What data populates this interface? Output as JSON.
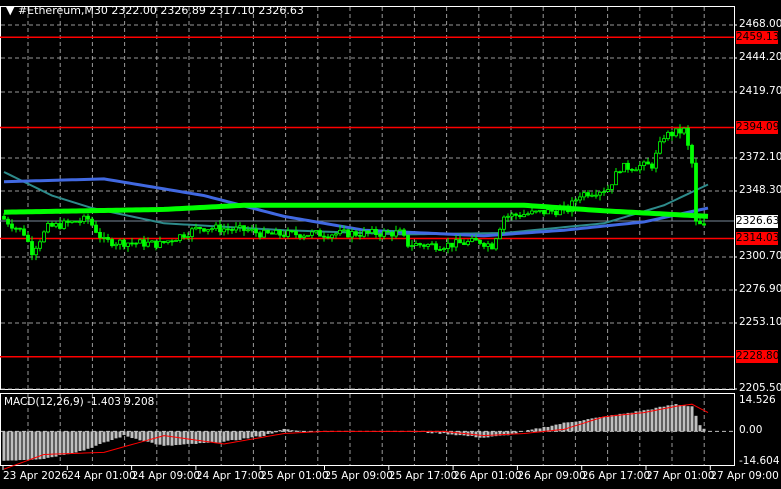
{
  "header": {
    "symbol": "#Ethereum,M30",
    "open": "2322.00",
    "high": "2326.89",
    "low": "2317.10",
    "close": "2326.63"
  },
  "price_axis": [
    "2468.00",
    "2444.20",
    "2419.70",
    "2372.10",
    "2348.30",
    "2300.70",
    "2276.90",
    "2253.10",
    "2205.50"
  ],
  "levels": [
    {
      "label": "2459.13",
      "price": 2459.13,
      "color": "#ff0000"
    },
    {
      "label": "2394.09",
      "price": 2394.09,
      "color": "#ff0000"
    },
    {
      "label": "2314.03",
      "price": 2314.03,
      "color": "#ff0000"
    },
    {
      "label": "2228.80",
      "price": 2228.8,
      "color": "#ff0000"
    }
  ],
  "current_price": {
    "label": "2326.63",
    "price": 2326.63
  },
  "macd": {
    "label": "MACD(12,26,9) -1.403 9.208",
    "axis": [
      "14.526",
      "0.00",
      "-14.604"
    ]
  },
  "time_axis": [
    "23 Apr 2026",
    "24 Apr 01:00",
    "24 Apr 09:00",
    "24 Apr 17:00",
    "25 Apr 01:00",
    "25 Apr 09:00",
    "25 Apr 17:00",
    "26 Apr 01:00",
    "26 Apr 09:00",
    "26 Apr 17:00",
    "27 Apr 01:00",
    "27 Apr 09:00"
  ],
  "chart_data": {
    "type": "candlestick",
    "ylim": [
      2205.5,
      2468.0
    ],
    "bars": 176,
    "close_keypoints": [
      [
        0,
        2330
      ],
      [
        6,
        2318
      ],
      [
        8,
        2305
      ],
      [
        12,
        2322
      ],
      [
        22,
        2328
      ],
      [
        26,
        2312
      ],
      [
        40,
        2310
      ],
      [
        50,
        2322
      ],
      [
        62,
        2320
      ],
      [
        66,
        2317
      ],
      [
        100,
        2318
      ],
      [
        102,
        2310
      ],
      [
        110,
        2309
      ],
      [
        120,
        2312
      ],
      [
        123,
        2309
      ],
      [
        126,
        2330
      ],
      [
        142,
        2335
      ],
      [
        145,
        2346
      ],
      [
        152,
        2350
      ],
      [
        155,
        2365
      ],
      [
        163,
        2367
      ],
      [
        166,
        2388
      ],
      [
        171,
        2392
      ],
      [
        173,
        2368
      ],
      [
        174,
        2325
      ],
      [
        176,
        2322
      ]
    ],
    "ma_green": [
      [
        0,
        2333
      ],
      [
        40,
        2335
      ],
      [
        60,
        2338
      ],
      [
        100,
        2338
      ],
      [
        130,
        2338
      ],
      [
        150,
        2334
      ],
      [
        176,
        2330
      ]
    ],
    "ma_blue": [
      [
        0,
        2355
      ],
      [
        25,
        2357
      ],
      [
        50,
        2345
      ],
      [
        70,
        2330
      ],
      [
        90,
        2320
      ],
      [
        120,
        2316
      ],
      [
        140,
        2320
      ],
      [
        160,
        2326
      ],
      [
        176,
        2336
      ]
    ],
    "ma_teal": [
      [
        0,
        2362
      ],
      [
        12,
        2345
      ],
      [
        22,
        2336
      ],
      [
        40,
        2325
      ],
      [
        70,
        2320
      ],
      [
        100,
        2317
      ],
      [
        125,
        2318
      ],
      [
        150,
        2325
      ],
      [
        165,
        2338
      ],
      [
        176,
        2353
      ]
    ],
    "macd_hist": [
      [
        0,
        -14
      ],
      [
        10,
        -13
      ],
      [
        20,
        -9
      ],
      [
        30,
        -2
      ],
      [
        40,
        -7
      ],
      [
        55,
        -5
      ],
      [
        65,
        -2
      ],
      [
        70,
        1
      ],
      [
        75,
        0
      ],
      [
        100,
        0
      ],
      [
        110,
        -1
      ],
      [
        120,
        -3
      ],
      [
        125,
        -2
      ],
      [
        130,
        0
      ],
      [
        140,
        4
      ],
      [
        150,
        7
      ],
      [
        160,
        10
      ],
      [
        168,
        13
      ],
      [
        172,
        12
      ],
      [
        174,
        3
      ],
      [
        176,
        -1
      ]
    ],
    "macd_signal": [
      [
        0,
        -18
      ],
      [
        10,
        -11
      ],
      [
        25,
        -10
      ],
      [
        40,
        -2
      ],
      [
        55,
        -6
      ],
      [
        70,
        -1
      ],
      [
        80,
        0
      ],
      [
        110,
        0
      ],
      [
        120,
        -2
      ],
      [
        130,
        -1
      ],
      [
        140,
        1
      ],
      [
        150,
        7
      ],
      [
        160,
        9
      ],
      [
        168,
        12
      ],
      [
        172,
        13
      ],
      [
        176,
        9
      ]
    ],
    "macd_ylim": [
      -14.604,
      14.526
    ]
  }
}
